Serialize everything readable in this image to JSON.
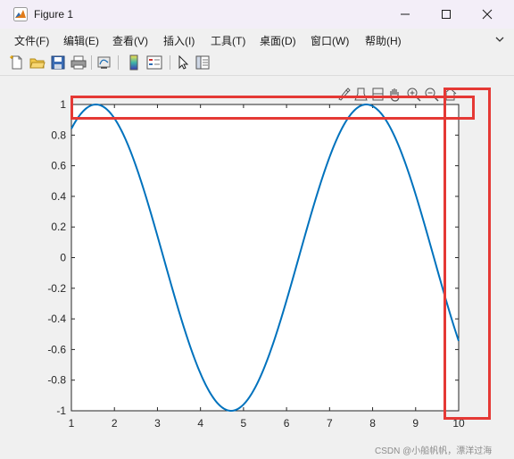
{
  "window": {
    "title": "Figure 1"
  },
  "menu": [
    {
      "label": "文件(F)"
    },
    {
      "label": "编辑(E)"
    },
    {
      "label": "查看(V)"
    },
    {
      "label": "插入(I)"
    },
    {
      "label": "工具(T)"
    },
    {
      "label": "桌面(D)"
    },
    {
      "label": "窗口(W)"
    },
    {
      "label": "帮助(H)"
    }
  ],
  "toolbar": [
    "new-figure-icon",
    "open-file-icon",
    "save-icon",
    "print-icon",
    "link-plot-icon",
    "colorbar-icon",
    "legend-icon",
    "pointer-icon",
    "property-editor-icon"
  ],
  "axes_toolbar": [
    "brush-icon",
    "data-tips-icon",
    "rotate-icon",
    "pan-icon",
    "zoom-in-icon",
    "zoom-out-icon",
    "home-icon"
  ],
  "chart_data": {
    "type": "line",
    "function_shape": "sine",
    "x_range": [
      1,
      10
    ],
    "ylim": [
      -1,
      1
    ],
    "xticks": [
      "1",
      "2",
      "3",
      "4",
      "5",
      "6",
      "7",
      "8",
      "9",
      "10"
    ],
    "yticks": [
      "1",
      "0.8",
      "0.6",
      "0.4",
      "0.2",
      "0",
      "-0.2",
      "-0.4",
      "-0.6",
      "-0.8",
      "-1"
    ],
    "series": [
      {
        "color": "#0072bd",
        "x": [
          1,
          1.5708,
          2,
          3,
          4,
          4.7124,
          5,
          6,
          7,
          7.854,
          8,
          9,
          10
        ],
        "y": [
          0.841,
          1.0,
          0.909,
          0.141,
          -0.757,
          -1.0,
          -0.959,
          -0.279,
          0.657,
          1.0,
          0.989,
          0.412,
          -0.544
        ]
      }
    ],
    "grid": false
  },
  "annotations": {
    "highlight_color": "#e53935"
  },
  "watermark": "CSDN @小船帆帆，漂洋过海"
}
